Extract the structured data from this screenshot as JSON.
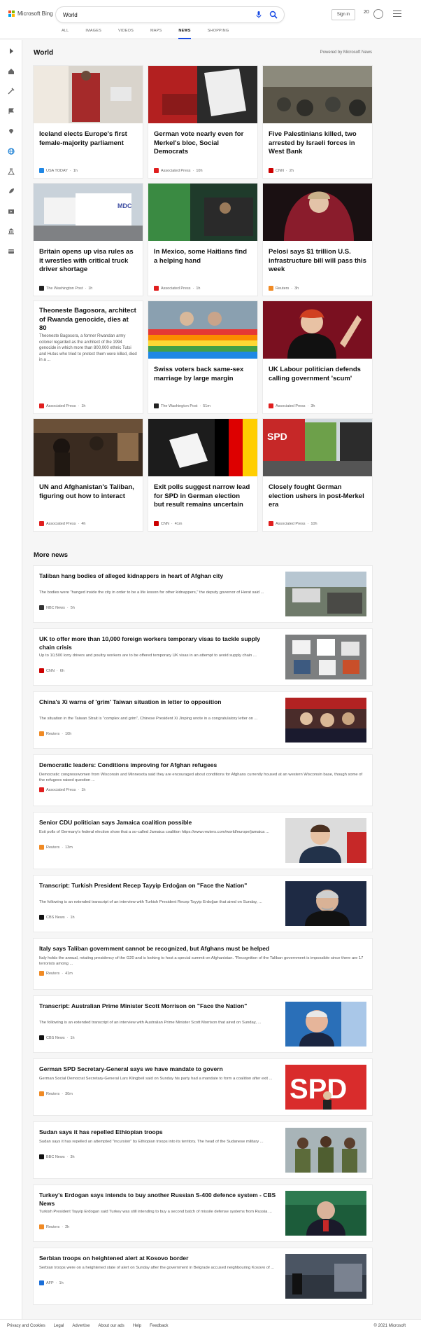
{
  "header": {
    "brand": "Microsoft Bing",
    "search_value": "World",
    "signin_label": "Sign in",
    "rewards_count": "20",
    "tabs": [
      {
        "label": "ALL"
      },
      {
        "label": "IMAGES"
      },
      {
        "label": "VIDEOS"
      },
      {
        "label": "MAPS"
      },
      {
        "label": "NEWS",
        "active": true
      },
      {
        "label": "SHOPPING"
      }
    ]
  },
  "sidebar": {
    "icons": [
      "expand-arrow-icon",
      "home-icon",
      "tools-icon",
      "flag-icon",
      "location-icon",
      "globe-icon",
      "science-icon",
      "rocket-icon",
      "entertainment-icon",
      "bank-icon",
      "card-icon"
    ]
  },
  "section": {
    "title": "World",
    "powered": "Powered by Microsoft News"
  },
  "cards": [
    {
      "title": "Iceland elects Europe's first female-majority parliament",
      "source": "USA TODAY",
      "time": "1h",
      "logo_color": "#1f87e5"
    },
    {
      "title": "German vote nearly even for Merkel's bloc, Social Democrats",
      "source": "Associated Press",
      "time": "10h",
      "logo_color": "#e01e1e"
    },
    {
      "title": "Five Palestinians killed, two arrested by Israeli forces in West Bank",
      "source": "CNN",
      "time": "2h",
      "logo_color": "#cc0000"
    },
    {
      "title": "Britain opens up visa rules as it wrestles with critical truck driver shortage",
      "source": "The Washington Post",
      "time": "1h",
      "logo_color": "#222222"
    },
    {
      "title": "In Mexico, some Haitians find a helping hand",
      "source": "Associated Press",
      "time": "1h",
      "logo_color": "#e01e1e"
    },
    {
      "title": "Pelosi says $1 trillion U.S. infrastructure bill will pass this week",
      "source": "Reuters",
      "time": "3h",
      "logo_color": "#f08a24"
    },
    {
      "title": "Theoneste Bagosora, architect of Rwanda genocide, dies at 80",
      "snippet": "Theoneste Bagosora, a former Rwandan army colonel regarded as the architect of the 1994 genocide in which more than 800,000 ethnic Tutsi and Hutus who tried to protect them were killed, died in a ...",
      "source": "Associated Press",
      "time": "1h",
      "logo_color": "#e01e1e"
    },
    {
      "title": "Swiss voters back same-sex marriage by large margin",
      "source": "The Washington Post",
      "time": "51m",
      "logo_color": "#222222"
    },
    {
      "title": "UK Labour politician defends calling government 'scum'",
      "source": "Associated Press",
      "time": "3h",
      "logo_color": "#e01e1e"
    },
    {
      "title": "UN and Afghanistan's Taliban, figuring out how to interact",
      "source": "Associated Press",
      "time": "4h",
      "logo_color": "#e01e1e"
    },
    {
      "title": "Exit polls suggest narrow lead for SPD in German election but result remains uncertain",
      "source": "CNN",
      "time": "41m",
      "logo_color": "#cc0000"
    },
    {
      "title": "Closely fought German election ushers in post-Merkel era",
      "source": "Associated Press",
      "time": "10h",
      "logo_color": "#e01e1e"
    }
  ],
  "more_news": {
    "title": "More news",
    "items": [
      {
        "title": "Taliban hang bodies of alleged kidnappers in heart of Afghan city",
        "snippet": "The bodies were \"hanged inside the city in order to be a life lesson for other kidnappers,\" the deputy governor of Herat said ...",
        "source": "NBC News",
        "time": "5h",
        "logo_color": "#333333"
      },
      {
        "title": "UK to offer more than 10,000 foreign workers temporary visas to tackle supply chain crisis",
        "snippet": "Up to 10,500 lorry drivers and poultry workers are to be offered temporary UK visas in an attempt to avoid supply chain ...",
        "source": "CNN",
        "time": "6h",
        "logo_color": "#cc0000"
      },
      {
        "title": "China's Xi warns of 'grim' Taiwan situation in letter to opposition",
        "snippet": "The situation in the Taiwan Strait is \"complex and grim\", Chinese President Xi Jinping wrote in a congratulatory letter on ...",
        "source": "Reuters",
        "time": "10h",
        "logo_color": "#f08a24"
      },
      {
        "title": "Democratic leaders: Conditions improving for Afghan refugees",
        "snippet": "Democratic congresswomen from Wisconsin and Minnesota said they are encouraged about conditions for Afghans currently housed at an western Wisconsin base, though some of the refugees raised question ...",
        "source": "Associated Press",
        "time": "1h",
        "logo_color": "#e01e1e"
      },
      {
        "title": "Senior CDU politician says Jamaica coalition possible",
        "snippet": "Exit polls of Germany's federal election show that a so-called Jamaica coalition https://www.reuters.com/world/europe/jamaica ...",
        "source": "Reuters",
        "time": "13m",
        "logo_color": "#f08a24"
      },
      {
        "title": "Transcript: Turkish President Recep Tayyip Erdoğan on \"Face the Nation\"",
        "snippet": "The following is an extended transcript of an interview with Turkish President Recep Tayyip Erdoğan that aired on Sunday, ...",
        "source": "CBS News",
        "time": "1h",
        "logo_color": "#111111"
      },
      {
        "title": "Italy says Taliban government cannot be recognized, but Afghans must be helped",
        "snippet": "Italy holds the annual, rotating presidency of the G20 and is looking to host a special summit on Afghanistan. \"Recognition of the Taliban government is impossible since there are 17 terrorists among ...",
        "source": "Reuters",
        "time": "41m",
        "logo_color": "#f08a24"
      },
      {
        "title": "Transcript: Australian Prime Minister Scott Morrison on \"Face the Nation\"",
        "snippet": "The following is an extended transcript of an interview with Australian Prime Minister Scott Morrison that aired on Sunday, ...",
        "source": "CBS News",
        "time": "1h",
        "logo_color": "#111111"
      },
      {
        "title": "German SPD Secretary-General says we have mandate to govern",
        "snippet": "German Social Democrat Secretary-General Lars Klingbeil said on Sunday his party had a mandate to form a coalition after exit ...",
        "source": "Reuters",
        "time": "30m",
        "logo_color": "#f08a24"
      },
      {
        "title": "Sudan says it has repelled Ethiopian troops",
        "snippet": "Sudan says it has repelled an attempted \"incursion\" by Ethiopian troops into its territory. The head of the Sudanese military ...",
        "source": "BBC News",
        "time": "3h",
        "logo_color": "#111111"
      },
      {
        "title": "Turkey's Erdogan says intends to buy another Russian S-400 defence system - CBS News",
        "snippet": "Turkish President Tayyip Erdogan said Turkey was still intending to buy a second batch of missile defense systems from Russia ...",
        "source": "Reuters",
        "time": "2h",
        "logo_color": "#f08a24"
      },
      {
        "title": "Serbian troops on heightened alert at Kosovo border",
        "snippet": "Serbian troops were on a heightened state of alert on Sunday after the government in Belgrade accused neighbouring Kosovo of ...",
        "source": "AFP",
        "time": "1h",
        "logo_color": "#1a6ed8"
      }
    ]
  },
  "footer": {
    "links": [
      "Privacy and Cookies",
      "Legal",
      "Advertise",
      "About our ads",
      "Help",
      "Feedback"
    ],
    "copyright": "© 2021 Microsoft"
  }
}
